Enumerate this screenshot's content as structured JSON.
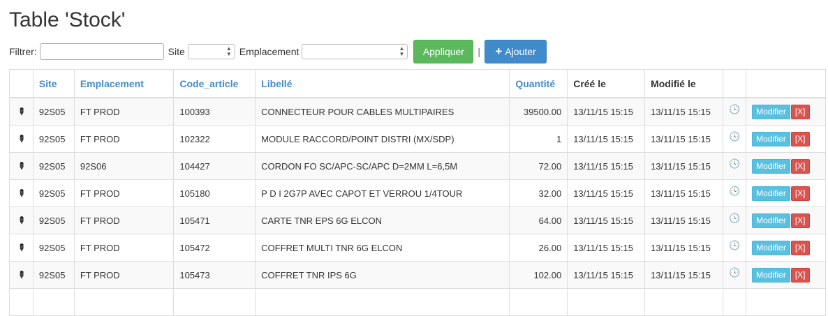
{
  "page": {
    "title": "Table 'Stock'"
  },
  "filter": {
    "filter_label": "Filtrer:",
    "filter_value": "",
    "site_label": "Site",
    "site_value": "",
    "emplacement_label": "Emplacement",
    "emplacement_value": "",
    "apply_label": "Appliquer",
    "separator": "|",
    "add_label": "Ajouter"
  },
  "table": {
    "headers": {
      "site": "Site",
      "emplacement": "Emplacement",
      "code_article": "Code_article",
      "libelle": "Libellé",
      "quantite": "Quantité",
      "cree_le": "Créé le",
      "modifie_le": "Modifié le"
    },
    "modify_label": "Modifier",
    "delete_label": "[X]",
    "rows": [
      {
        "site": "92S05",
        "emplacement": "FT PROD",
        "code": "100393",
        "libelle": "CONNECTEUR POUR CABLES MULTIPAIRES",
        "quantite": "39500.00",
        "cree": "13/11/15 15:15",
        "modifie": "13/11/15 15:15"
      },
      {
        "site": "92S05",
        "emplacement": "FT PROD",
        "code": "102322",
        "libelle": "MODULE RACCORD/POINT DISTRI (MX/SDP)",
        "quantite": "1",
        "cree": "13/11/15 15:15",
        "modifie": "13/11/15 15:15"
      },
      {
        "site": "92S05",
        "emplacement": "92S06",
        "code": "104427",
        "libelle": "CORDON FO SC/APC-SC/APC D=2MM L=6,5M",
        "quantite": "72.00",
        "cree": "13/11/15 15:15",
        "modifie": "13/11/15 15:15"
      },
      {
        "site": "92S05",
        "emplacement": "FT PROD",
        "code": "105180",
        "libelle": "P D I 2G7P AVEC CAPOT ET VERROU 1/4TOUR",
        "quantite": "32.00",
        "cree": "13/11/15 15:15",
        "modifie": "13/11/15 15:15"
      },
      {
        "site": "92S05",
        "emplacement": "FT PROD",
        "code": "105471",
        "libelle": "CARTE TNR EPS 6G ELCON",
        "quantite": "64.00",
        "cree": "13/11/15 15:15",
        "modifie": "13/11/15 15:15"
      },
      {
        "site": "92S05",
        "emplacement": "FT PROD",
        "code": "105472",
        "libelle": "COFFRET MULTI TNR 6G ELCON",
        "quantite": "26.00",
        "cree": "13/11/15 15:15",
        "modifie": "13/11/15 15:15"
      },
      {
        "site": "92S05",
        "emplacement": "FT PROD",
        "code": "105473",
        "libelle": "COFFRET TNR IPS 6G",
        "quantite": "102.00",
        "cree": "13/11/15 15:15",
        "modifie": "13/11/15 15:15"
      },
      {
        "site": "",
        "emplacement": "",
        "code": "",
        "libelle": "",
        "quantite": "",
        "cree": "",
        "modifie": ""
      }
    ]
  }
}
